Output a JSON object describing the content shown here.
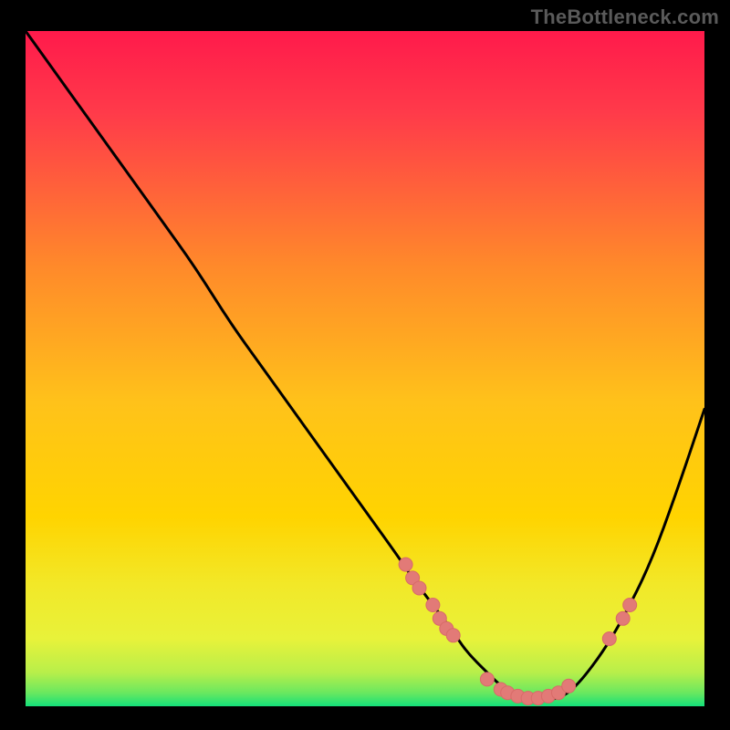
{
  "watermark": "TheBottleneck.com",
  "colors": {
    "background": "#000000",
    "curve": "#000000",
    "marker_fill": "#e27a77",
    "marker_stroke": "#d86b68",
    "grad_top": "#ff1a4b",
    "grad_mid": "#ffd400",
    "grad_bottom": "#14e07a"
  },
  "chart_data": {
    "type": "line",
    "title": "",
    "xlabel": "",
    "ylabel": "",
    "xlim": [
      0,
      100
    ],
    "ylim": [
      0,
      100
    ],
    "curve": {
      "x": [
        0,
        5,
        10,
        15,
        20,
        25,
        30,
        35,
        40,
        45,
        50,
        55,
        57,
        60,
        63,
        65,
        68,
        70,
        72,
        75,
        78,
        80,
        82,
        85,
        88,
        92,
        96,
        100
      ],
      "y": [
        100,
        93,
        86,
        79,
        72,
        65,
        57,
        50,
        43,
        36,
        29,
        22,
        19,
        15,
        11,
        8,
        5,
        3,
        2,
        1,
        1,
        2,
        4,
        8,
        13,
        21,
        32,
        44
      ]
    },
    "markers_left_branch": [
      {
        "x": 56,
        "y": 21
      },
      {
        "x": 57,
        "y": 19
      },
      {
        "x": 58,
        "y": 17.5
      },
      {
        "x": 60,
        "y": 15
      },
      {
        "x": 61,
        "y": 13
      },
      {
        "x": 62,
        "y": 11.5
      },
      {
        "x": 63,
        "y": 10.5
      }
    ],
    "markers_valley": [
      {
        "x": 68,
        "y": 4
      },
      {
        "x": 70,
        "y": 2.5
      },
      {
        "x": 71,
        "y": 2
      },
      {
        "x": 72.5,
        "y": 1.5
      },
      {
        "x": 74,
        "y": 1.2
      },
      {
        "x": 75.5,
        "y": 1.2
      },
      {
        "x": 77,
        "y": 1.5
      },
      {
        "x": 78.5,
        "y": 2
      },
      {
        "x": 80,
        "y": 3
      }
    ],
    "markers_right_branch": [
      {
        "x": 86,
        "y": 10
      },
      {
        "x": 88,
        "y": 13
      },
      {
        "x": 89,
        "y": 15
      }
    ]
  }
}
